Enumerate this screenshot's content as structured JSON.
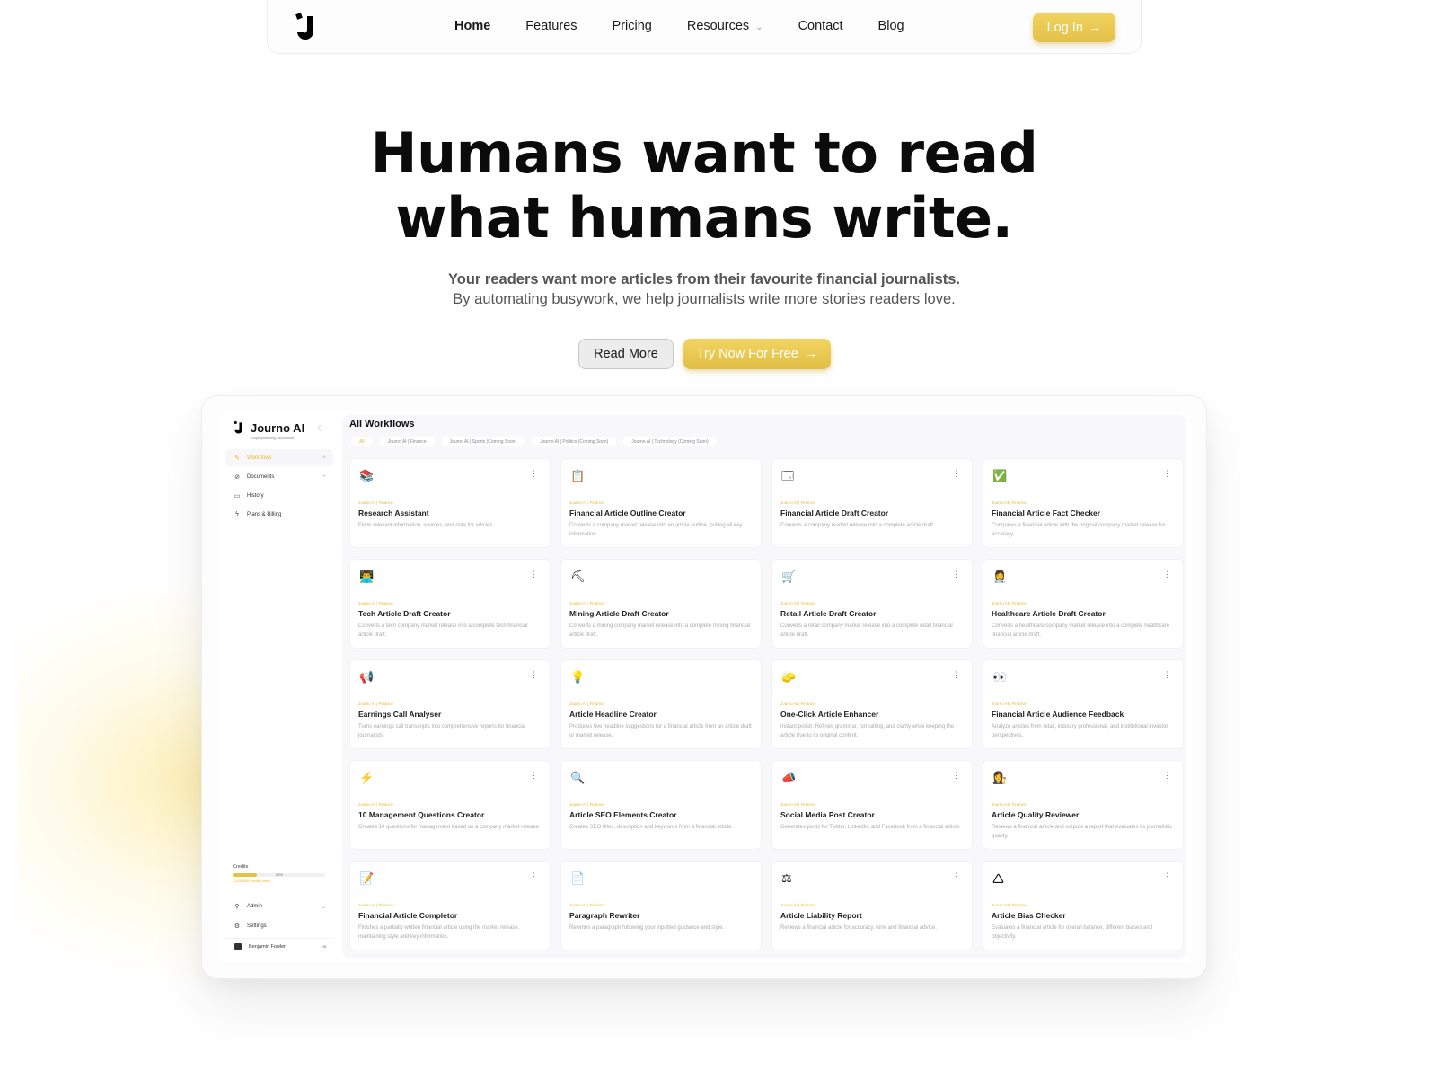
{
  "nav": {
    "links": [
      {
        "label": "Home",
        "active": true
      },
      {
        "label": "Features"
      },
      {
        "label": "Pricing"
      },
      {
        "label": "Resources",
        "has_dropdown": true
      },
      {
        "label": "Contact"
      },
      {
        "label": "Blog"
      }
    ],
    "login_label": "Log In",
    "login_icon": "arrow-right-icon",
    "arrow": "→",
    "chevron": "⌄"
  },
  "hero": {
    "title_line1": "Humans want to read",
    "title_line2": "what humans write.",
    "subtitle_bold": "Your readers want more articles from their favourite financial journalists.",
    "subtitle": "By automating busywork, we help journalists write more stories readers love.",
    "read_more_label": "Read More",
    "try_label": "Try Now For Free",
    "try_arrow": "→"
  },
  "colors": {
    "accent": "#e7c142",
    "accent_text": "#e7b82b"
  },
  "app": {
    "brand_name": "Journo AI",
    "brand_tagline": "Superpowering Journalists",
    "moon_icon": "☾",
    "sidebar": [
      {
        "label": "Workflows",
        "icon": "✎",
        "icon_name": "pencil-icon",
        "active": true,
        "plus": "+"
      },
      {
        "label": "Documents",
        "icon": "⊘",
        "icon_name": "documents-icon",
        "plus": "+"
      },
      {
        "label": "History",
        "icon": "▭",
        "icon_name": "calendar-icon"
      },
      {
        "label": "Plans & Billing",
        "icon": "ϟ",
        "icon_name": "bolt-icon"
      }
    ],
    "credits": {
      "label": "Credits",
      "percent": 26,
      "percent_label": "26%",
      "used_label": "1243/4800 credits used"
    },
    "footer": [
      {
        "label": "Admin",
        "icon": "⚲",
        "icon_name": "key-icon",
        "chevron": "⌄"
      },
      {
        "label": "Settings",
        "icon": "⚙",
        "icon_name": "settings-icon"
      }
    ],
    "user": {
      "name": "Benjamin Fowler",
      "logout_icon": "⇥"
    },
    "main_title": "All Workflows",
    "filters": [
      {
        "label": "All",
        "active": true
      },
      {
        "label": "Journo AI | Finance"
      },
      {
        "label": "Journo AI | Sports (Coming Soon)"
      },
      {
        "label": "Journo AI | Politics (Coming Soon)"
      },
      {
        "label": "Journo AI | Technology (Coming Soon)"
      }
    ],
    "menu_glyph": "⋮",
    "workflows": [
      {
        "icon": "📚",
        "icon_name": "books-icon",
        "category": "Journo AI | Finance",
        "title": "Research Assistant",
        "desc": "Finds relevant information, sources, and data for articles."
      },
      {
        "icon": "📋",
        "icon_name": "clipboard-icon",
        "category": "Journo AI | Finance",
        "title": "Financial Article Outline Creator",
        "desc": "Converts a company market release into an article outline, pulling all key information."
      },
      {
        "icon": "🗔",
        "icon_name": "window-icon",
        "category": "Journo AI | Finance",
        "title": "Financial Article Draft Creator",
        "desc": "Converts a company market release into a complete article draft."
      },
      {
        "icon": "✅",
        "icon_name": "check-box-icon",
        "category": "Journo AI | Finance",
        "title": "Financial Article Fact Checker",
        "desc": "Compares a financial article with the original company market release for accuracy."
      },
      {
        "icon": "👨‍💻",
        "icon_name": "technologist-icon",
        "category": "Journo AI | Finance",
        "title": "Tech Article Draft Creator",
        "desc": "Converts a tech company market release into a complete tech financial article draft."
      },
      {
        "icon": "⛏",
        "icon_name": "pick-icon",
        "category": "Journo AI | Finance",
        "title": "Mining Article Draft Creator",
        "desc": "Converts a mining company market release into a complete mining financial article draft."
      },
      {
        "icon": "🛒",
        "icon_name": "cart-icon",
        "category": "Journo AI | Finance",
        "title": "Retail Article Draft Creator",
        "desc": "Converts a retail company market release into a complete retail financial article draft."
      },
      {
        "icon": "👩‍⚕️",
        "icon_name": "health-worker-icon",
        "category": "Journo AI | Finance",
        "title": "Healthcare Article Draft Creator",
        "desc": "Converts a healthcare company market release into a complete healthcare financial article draft."
      },
      {
        "icon": "📢",
        "icon_name": "megaphone-icon",
        "category": "Journo AI | Finance",
        "title": "Earnings Call Analyser",
        "desc": "Turns earnings call transcripts into comprehensive reports for financial journalists."
      },
      {
        "icon": "💡",
        "icon_name": "lightbulb-icon",
        "category": "Journo AI | Finance",
        "title": "Article Headline Creator",
        "desc": "Produces five headline suggestions for a financial article from an article draft or market release."
      },
      {
        "icon": "🧽",
        "icon_name": "sponge-icon",
        "category": "Journo AI | Finance",
        "title": "One-Click Article Enhancer",
        "desc": "Instant polish: Refines grammar, formatting, and clarity while keeping the article true to its original content."
      },
      {
        "icon": "👀",
        "icon_name": "eyes-icon",
        "category": "Journo AI | Finance",
        "title": "Financial Article Audience Feedback",
        "desc": "Analyze articles from retail, industry professional, and institutional investor perspectives."
      },
      {
        "icon": "⚡",
        "icon_name": "lightning-icon",
        "category": "Journo AI | Finance",
        "title": "10 Management Questions Creator",
        "desc": "Creates 10 questions for management based on a company market release."
      },
      {
        "icon": "🔍",
        "icon_name": "magnifier-icon",
        "category": "Journo AI | Finance",
        "title": "Article SEO Elements Creator",
        "desc": "Creates SEO titles, description and keywords from a financial article."
      },
      {
        "icon": "📣",
        "icon_name": "loudspeaker-icon",
        "category": "Journo AI | Finance",
        "title": "Social Media Post Creator",
        "desc": "Generates posts for Twitter, LinkedIn, and Facebook from a financial article."
      },
      {
        "icon": "👩‍⚖️",
        "icon_name": "judge-icon",
        "category": "Journo AI | Finance",
        "title": "Article Quality Reviewer",
        "desc": "Reviews a financial article and outputs a report that evaluates its journalistic quality."
      },
      {
        "icon": "📝",
        "icon_name": "memo-icon",
        "category": "Journo AI | Finance",
        "title": "Financial Article Completor",
        "desc": "Finishes a partially written financial article using the market release, maintaining style and key information."
      },
      {
        "icon": "📄",
        "icon_name": "page-icon",
        "category": "Journo AI | Finance",
        "title": "Paragraph Rewriter",
        "desc": "Rewrites a paragraph following your inputted guidance and style."
      },
      {
        "icon": "⚖",
        "icon_name": "scales-icon",
        "category": "Journo AI | Finance",
        "title": "Article Liability Report",
        "desc": "Reviews a financial article for accuracy, tone and financial advice."
      },
      {
        "icon": "🛆",
        "icon_name": "bias-icon",
        "category": "Journo AI | Finance",
        "title": "Article Bias Checker",
        "desc": "Evaluates a financial article for overall balance, different biases and objectivity."
      }
    ]
  }
}
